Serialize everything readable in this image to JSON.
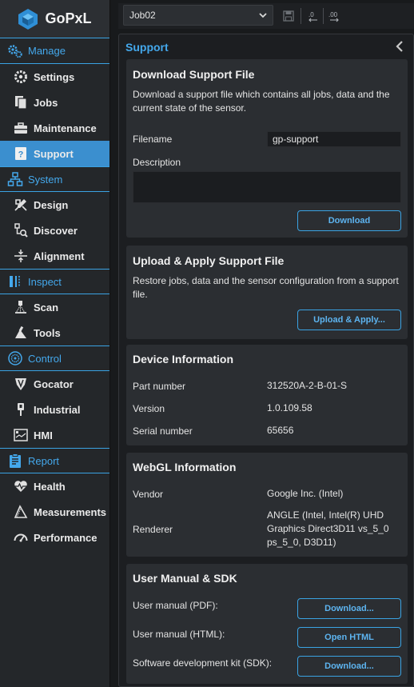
{
  "app": {
    "logo_text": "GoPxL"
  },
  "sidebar": {
    "sections": [
      {
        "title": "Manage",
        "items": [
          {
            "label": "Settings"
          },
          {
            "label": "Jobs"
          },
          {
            "label": "Maintenance"
          },
          {
            "label": "Support"
          }
        ]
      },
      {
        "title": "System",
        "items": [
          {
            "label": "Design"
          },
          {
            "label": "Discover"
          },
          {
            "label": "Alignment"
          }
        ]
      },
      {
        "title": "Inspect",
        "items": [
          {
            "label": "Scan"
          },
          {
            "label": "Tools"
          }
        ]
      },
      {
        "title": "Control",
        "items": [
          {
            "label": "Gocator"
          },
          {
            "label": "Industrial"
          },
          {
            "label": "HMI"
          }
        ]
      },
      {
        "title": "Report",
        "items": [
          {
            "label": "Health"
          },
          {
            "label": "Measurements"
          },
          {
            "label": "Performance"
          }
        ]
      }
    ],
    "active": "Support"
  },
  "toolbar": {
    "job_value": "Job02"
  },
  "panel": {
    "title": "Support"
  },
  "download_support": {
    "title": "Download Support File",
    "description": "Download a support file which contains all jobs, data and the current state of the sensor.",
    "filename_label": "Filename",
    "filename_value": "gp-support",
    "description_label": "Description",
    "description_value": "",
    "button": "Download"
  },
  "upload_support": {
    "title": "Upload & Apply Support File",
    "description": "Restore jobs, data and the sensor configuration from a support file.",
    "button": "Upload & Apply..."
  },
  "device_info": {
    "title": "Device Information",
    "rows": [
      {
        "label": "Part number",
        "value": "312520A-2-B-01-S"
      },
      {
        "label": "Version",
        "value": "1.0.109.58"
      },
      {
        "label": "Serial number",
        "value": "65656"
      }
    ]
  },
  "webgl_info": {
    "title": "WebGL Information",
    "vendor_label": "Vendor",
    "vendor_value": "Google Inc. (Intel)",
    "renderer_label": "Renderer",
    "renderer_value": "ANGLE (Intel, Intel(R) UHD Graphics Direct3D11 vs_5_0 ps_5_0, D3D11)"
  },
  "manual_sdk": {
    "title": "User Manual & SDK",
    "rows": [
      {
        "label": "User manual (PDF):",
        "button": "Download..."
      },
      {
        "label": "User manual (HTML):",
        "button": "Open HTML"
      },
      {
        "label": "Software development kit (SDK):",
        "button": "Download..."
      }
    ]
  },
  "colors": {
    "accent": "#3aa3e3",
    "active_nav": "#3b8fcf",
    "card_bg": "#2b2e32",
    "sidebar_bg": "#24272a"
  }
}
